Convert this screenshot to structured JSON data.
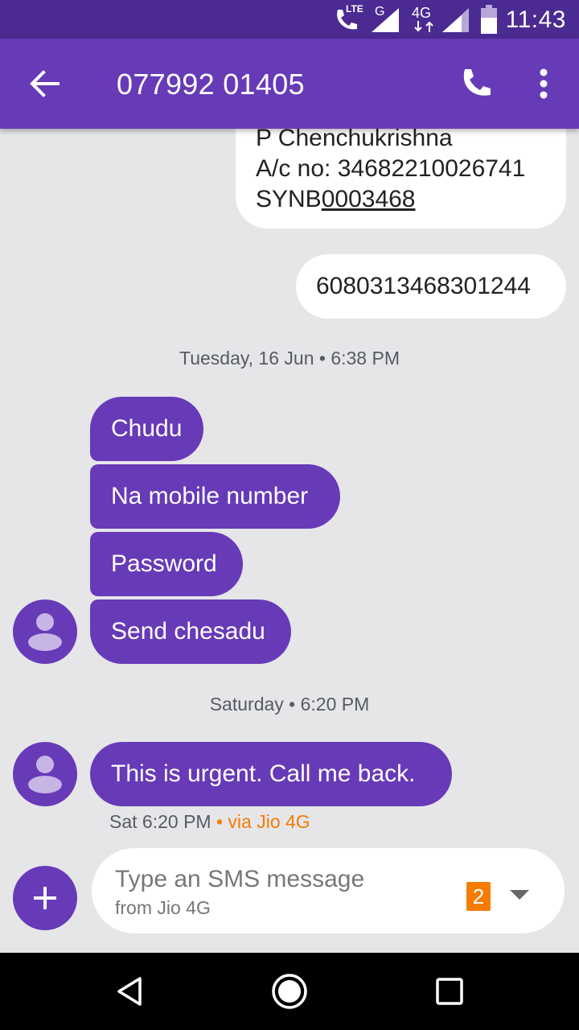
{
  "status_bar": {
    "time": "11:43",
    "icons": [
      "lte-call-icon",
      "signal-g-icon",
      "network-4g-icon",
      "signal-icon",
      "battery-icon"
    ],
    "lte_label": "LTE",
    "g_label": "G",
    "fourg_label": "4G"
  },
  "header": {
    "title": "077992 01405",
    "back_icon": "arrow-back-icon",
    "call_icon": "phone-icon",
    "menu_icon": "more-vert-icon"
  },
  "messages": {
    "outgoing_1": {
      "line1": "P Chenchukrishna",
      "line2": "A/c no: 34682210026741",
      "line3_plain": "SYNB",
      "line3_link": "0003468"
    },
    "outgoing_2": "6080313468301244",
    "date_1": "Tuesday, 16 Jun • 6:38 PM",
    "incoming_group": [
      "Chudu",
      "Na mobile number",
      "Password",
      "Send chesadu"
    ],
    "date_2": "Saturday • 6:20 PM",
    "incoming_last": "This is urgent. Call me back.",
    "last_meta_time": "Sat 6:20 PM",
    "last_meta_via": "• via Jio 4G"
  },
  "compose": {
    "placeholder": "Type an SMS message",
    "subtext": "from Jio 4G",
    "sim_badge": "2",
    "add_icon": "plus-icon",
    "dropdown_icon": "arrow-drop-down-icon"
  },
  "nav_bar": {
    "icons": [
      "back-triangle-icon",
      "home-circle-icon",
      "recents-square-icon"
    ]
  },
  "colors": {
    "accent": "#673ab7",
    "status_bar": "#4b2a92",
    "background": "#e6e6e9",
    "via_text": "#f57c00"
  }
}
